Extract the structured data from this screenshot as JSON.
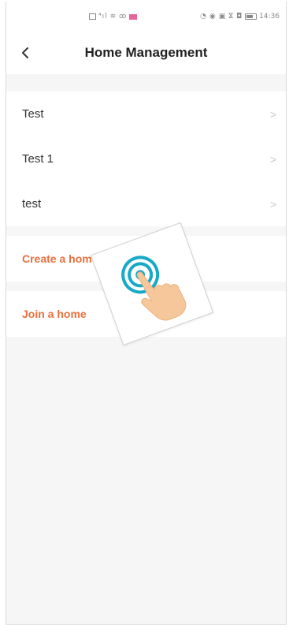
{
  "status_bar": {
    "time": "14:36"
  },
  "header": {
    "title": "Home Management"
  },
  "homes": [
    {
      "label": "Test"
    },
    {
      "label": "Test 1"
    },
    {
      "label": "test"
    }
  ],
  "actions": {
    "create_label": "Create a home",
    "join_label": "Join a home"
  },
  "colors": {
    "accent": "#e96f3d",
    "tap_ring": "#17a9c6",
    "hand": "#f5c79b"
  },
  "icons": {
    "back": "chevron-left-icon",
    "row_arrow": "chevron-right-icon",
    "tap_gesture": "tap-hand-icon"
  }
}
